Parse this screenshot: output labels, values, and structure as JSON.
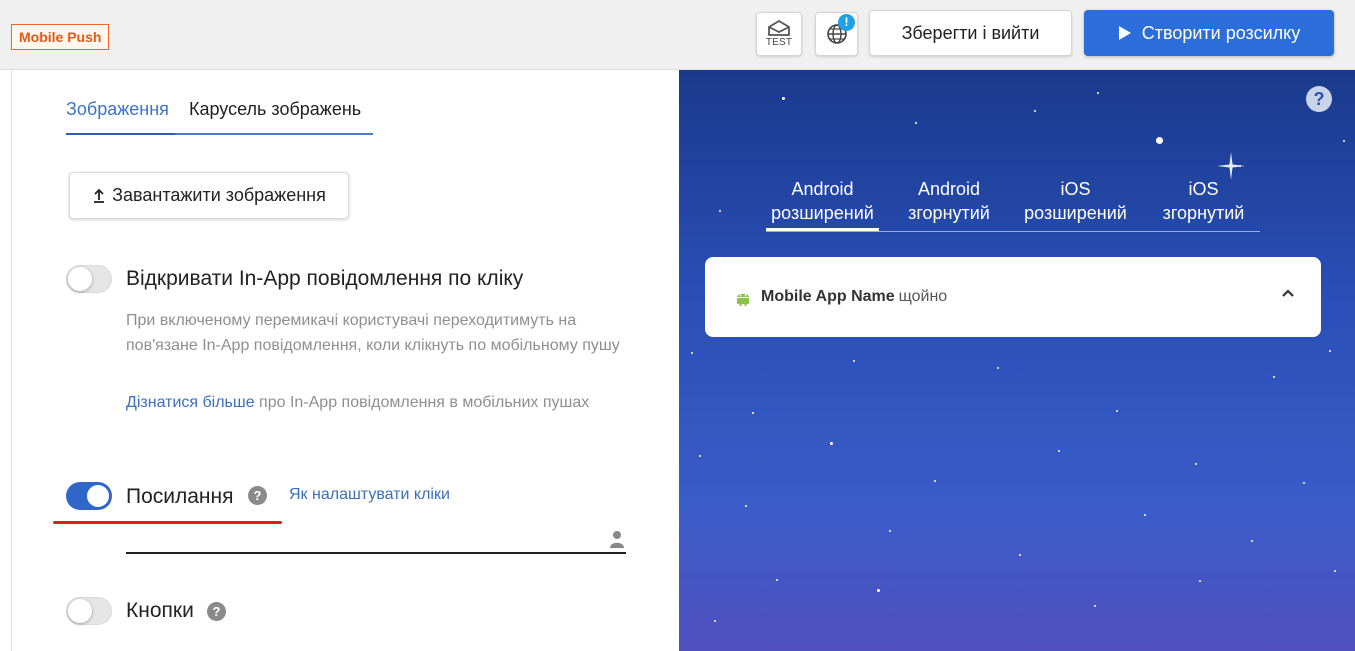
{
  "header": {
    "badge": "Mobile Push",
    "test_label": "TEST",
    "alert_mark": "!",
    "save_exit": "Зберегти і вийти",
    "create_mailing": "Створити розсилку",
    "icons": [
      "test-envelope-icon",
      "globe-icon",
      "play-icon"
    ],
    "accent_color": "#2c6ed9"
  },
  "left": {
    "tabs": [
      {
        "label": "Зображення",
        "active": true
      },
      {
        "label": "Карусель зображень",
        "active": false
      }
    ],
    "upload_label": "Завантажити зображення",
    "inapp": {
      "title": "Відкривати In-App повідомлення по кліку",
      "enabled": false,
      "description": "При включеному перемикачі користувачі переходитимуть на пов'язане In-App повідомлення, коли клікнуть по мобільному пушу",
      "learn_more_link": "Дізнатися більше",
      "learn_more_rest": " про In-App повідомлення в мобільних пушах"
    },
    "link": {
      "title": "Посилання",
      "enabled": true,
      "help_mark": "?",
      "how_to_link": "Як налаштувати кліки",
      "url_value": ""
    },
    "buttons": {
      "title": "Кнопки",
      "enabled": false,
      "help_mark": "?"
    }
  },
  "preview": {
    "help_mark": "?",
    "tabs": [
      {
        "line1": "Android",
        "line2": "розширений",
        "active": true
      },
      {
        "line1": "Android",
        "line2": "згорнутий",
        "active": false
      },
      {
        "line1": "iOS",
        "line2": "розширений",
        "active": false
      },
      {
        "line1": "iOS",
        "line2": "згорнутий",
        "active": false
      }
    ],
    "notification": {
      "app_name": "Mobile App Name",
      "time": "щойно"
    }
  }
}
